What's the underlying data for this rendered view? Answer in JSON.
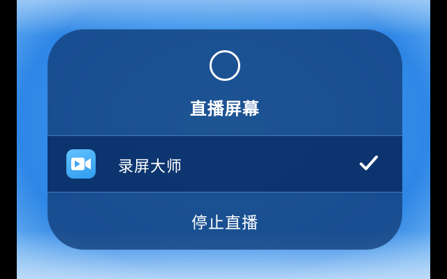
{
  "dialog": {
    "title": "直播屏幕",
    "record_icon": "record-ring-icon",
    "apps": [
      {
        "name": "录屏大师",
        "icon": "video-camera-icon",
        "selected": true,
        "check_icon": "checkmark-icon"
      }
    ],
    "stop_label": "停止直播"
  },
  "colors": {
    "background": "#3a93ec",
    "panel": "#153f78",
    "selected_row": "#0a3069",
    "app_icon": "#3fa8f5",
    "text": "#ffffff"
  }
}
